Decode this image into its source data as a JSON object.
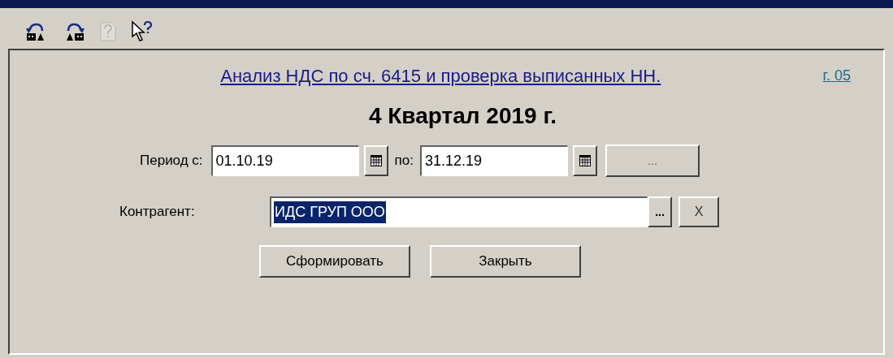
{
  "toolbar": {
    "buttons": [
      {
        "kind": "undo",
        "disabled": false
      },
      {
        "kind": "redo",
        "disabled": false
      },
      {
        "kind": "help",
        "disabled": true
      },
      {
        "kind": "whatsthis",
        "disabled": false
      }
    ]
  },
  "report_link": "Анализ НДС по сч. 6415 и проверка выписанных НН.",
  "form_ref": "г. 05",
  "heading": "4 Квартал 2019 г.",
  "period": {
    "from_label": "Период с:",
    "from": "01.10.19",
    "to_label": "по:",
    "to": "31.12.19",
    "more_button": "..."
  },
  "counterparty": {
    "label": "Контрагент:",
    "value": "ИДС ГРУП ООО",
    "value_selected": true,
    "select_button": "...",
    "clear_button": "X"
  },
  "buttons": [
    "Сформировать",
    "Закрыть"
  ]
}
